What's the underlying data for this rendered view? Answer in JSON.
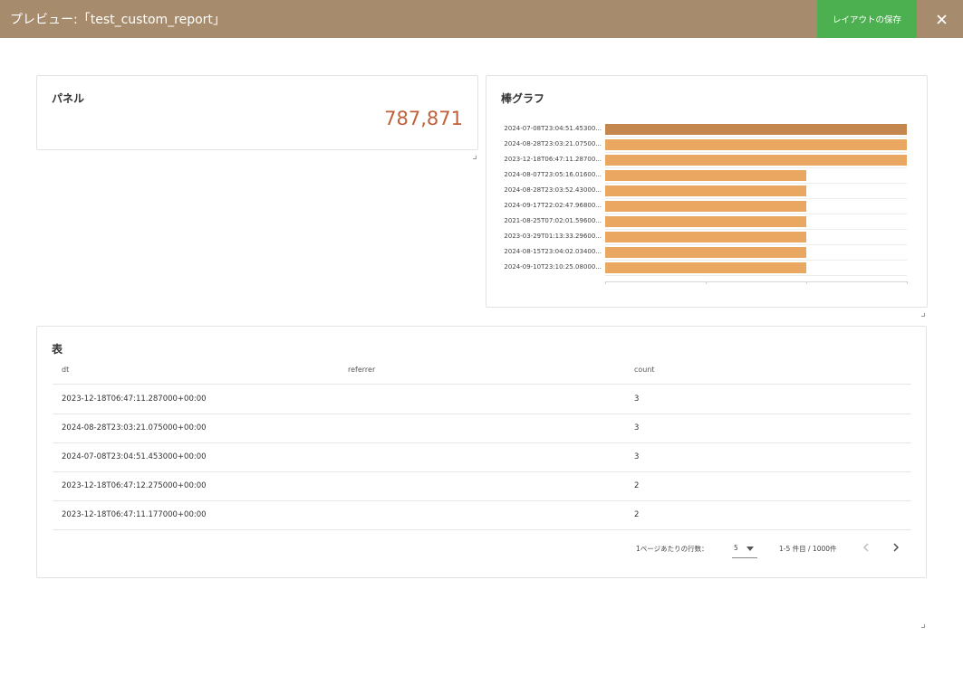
{
  "header": {
    "title": "プレビュー:「test_custom_report」",
    "save_label": "レイアウトの保存"
  },
  "panel": {
    "title": "パネル",
    "value": "787,871"
  },
  "bar_chart": {
    "title": "棒グラフ"
  },
  "chart_data": {
    "type": "bar",
    "orientation": "horizontal",
    "categories": [
      "2024-07-08T23:04:51.45300...",
      "2024-08-28T23:03:21.07500...",
      "2023-12-18T06:47:11.28700...",
      "2024-08-07T23:05:16.01600...",
      "2024-08-28T23:03:52.43000...",
      "2024-09-17T22:02:47.96800...",
      "2021-08-25T07:02:01.59600...",
      "2023-03-29T01:13:33.29600...",
      "2024-08-15T23:04:02.03400...",
      "2024-09-10T23:10:25.08000..."
    ],
    "values": [
      3,
      3,
      3,
      2,
      2,
      2,
      2,
      2,
      2,
      2
    ],
    "xlim": [
      0,
      3
    ],
    "colors": {
      "highlight": "#c4884e",
      "bar": "#e9a762"
    }
  },
  "table": {
    "title": "表",
    "headers": [
      "dt",
      "referrer",
      "count"
    ],
    "rows": [
      [
        "2023-12-18T06:47:11.287000+00:00",
        "",
        "3"
      ],
      [
        "2024-08-28T23:03:21.075000+00:00",
        "",
        "3"
      ],
      [
        "2024-07-08T23:04:51.453000+00:00",
        "",
        "3"
      ],
      [
        "2023-12-18T06:47:12.275000+00:00",
        "",
        "2"
      ],
      [
        "2023-12-18T06:47:11.177000+00:00",
        "",
        "2"
      ]
    ],
    "rows_per_page_label": "1ページあたりの行数：",
    "rows_per_page_value": "5",
    "range_label": "1-5 件目 / 1000件"
  },
  "colors": {
    "header_bg": "#a78b6d",
    "save_button": "#4caf50",
    "panel_value": "#c0603a"
  }
}
